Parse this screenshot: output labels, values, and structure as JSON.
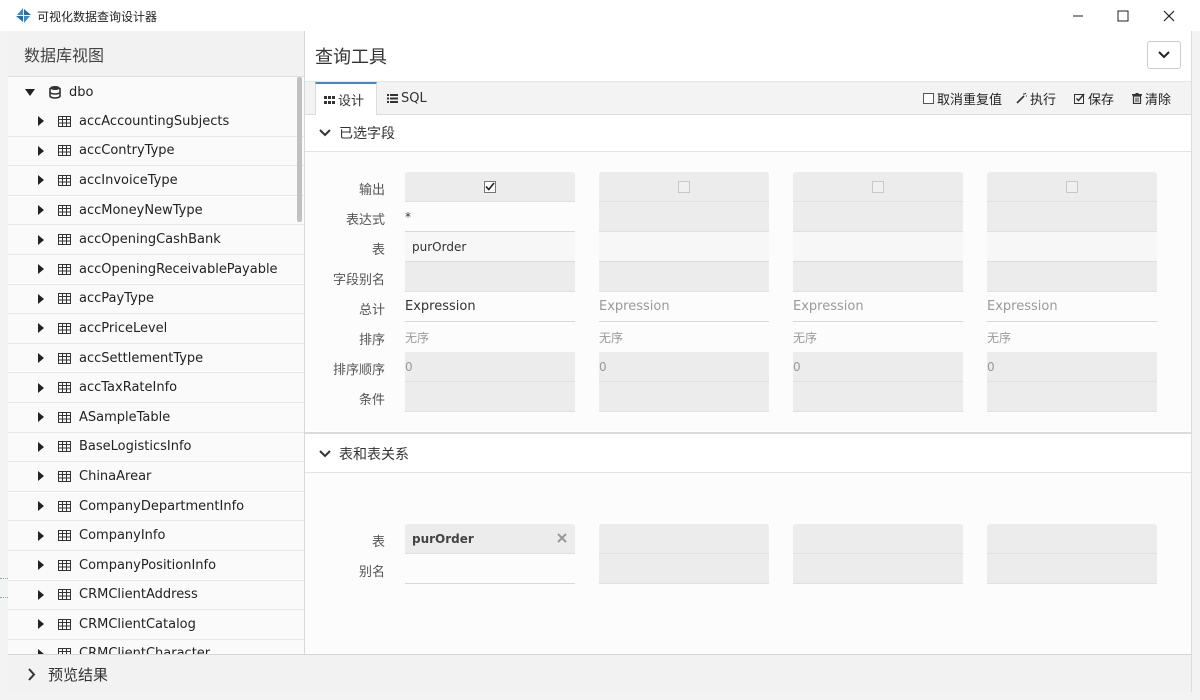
{
  "window": {
    "title": "可视化数据查询设计器",
    "accent": "#3c88c8"
  },
  "left_panel": {
    "header": "数据库视图",
    "root": "dbo",
    "items": [
      "accAccountingSubjects",
      "accContryType",
      "accInvoiceType",
      "accMoneyNewType",
      "accOpeningCashBank",
      "accOpeningReceivablePayable",
      "accPayType",
      "accPriceLevel",
      "accSettlementType",
      "accTaxRateInfo",
      "ASampleTable",
      "BaseLogisticsInfo",
      "ChinaArear",
      "CompanyDepartmentInfo",
      "CompanyInfo",
      "CompanyPositionInfo",
      "CRMClientAddress",
      "CRMClientCatalog",
      "CRMClientCharacter"
    ]
  },
  "query_tool": {
    "title": "查询工具",
    "tabs": {
      "design": "设计",
      "sql": "SQL"
    },
    "actions": {
      "dedupe": "取消重复值",
      "execute": "执行",
      "save": "保存",
      "clear": "清除"
    }
  },
  "fields_section": {
    "title": "已选字段",
    "row_labels": {
      "output": "输出",
      "expression": "表达式",
      "table": "表",
      "alias": "字段别名",
      "total": "总计",
      "sort": "排序",
      "sort_order": "排序顺序",
      "condition": "条件"
    },
    "columns": [
      {
        "output_checked": true,
        "expression": "*",
        "table": "purOrder",
        "alias": "",
        "total": "Expression",
        "sort": "无序",
        "sort_order": "0",
        "condition": ""
      },
      {
        "output_checked": false,
        "expression": "",
        "table": "",
        "alias": "",
        "total": "Expression",
        "sort": "无序",
        "sort_order": "0",
        "condition": ""
      },
      {
        "output_checked": false,
        "expression": "",
        "table": "",
        "alias": "",
        "total": "Expression",
        "sort": "无序",
        "sort_order": "0",
        "condition": ""
      },
      {
        "output_checked": false,
        "expression": "",
        "table": "",
        "alias": "",
        "total": "Expression",
        "sort": "无序",
        "sort_order": "0",
        "condition": ""
      }
    ]
  },
  "relations_section": {
    "title": "表和表关系",
    "row_labels": {
      "table": "表",
      "alias": "别名"
    },
    "columns": [
      {
        "table": "purOrder",
        "alias": ""
      },
      {
        "table": "",
        "alias": ""
      },
      {
        "table": "",
        "alias": ""
      },
      {
        "table": "",
        "alias": ""
      }
    ]
  },
  "bottom": {
    "title": "预览结果"
  }
}
